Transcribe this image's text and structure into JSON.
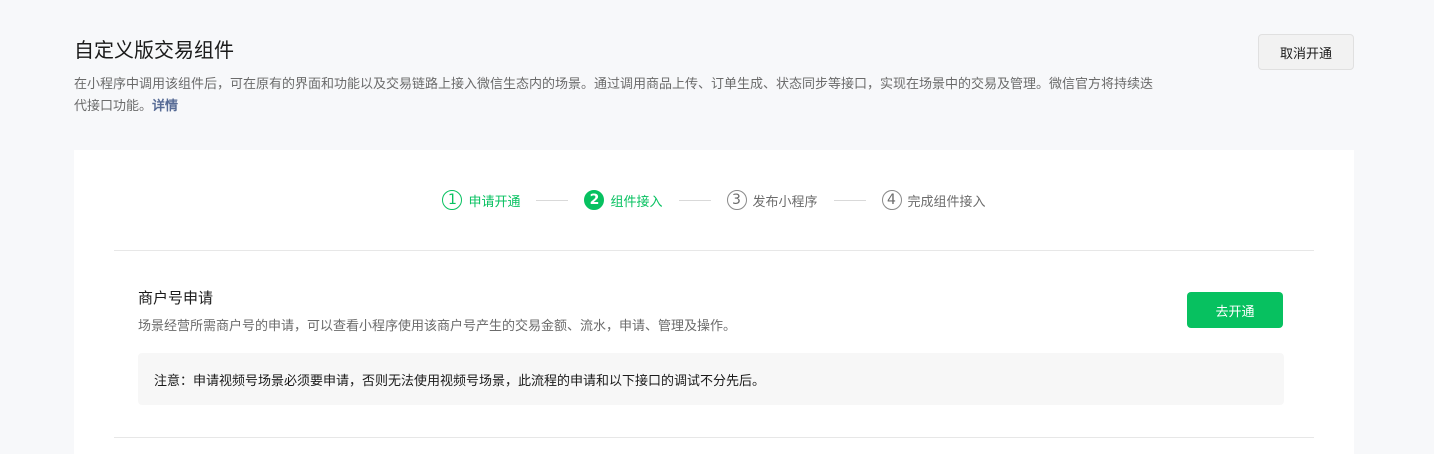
{
  "header": {
    "title": "自定义版交易组件",
    "description": "在小程序中调用该组件后，可在原有的界面和功能以及交易链路上接入微信生态内的场景。通过调用商品上传、订单生成、状态同步等接口，实现在场景中的交易及管理。微信官方将持续迭代接口功能。",
    "details_link": "详情",
    "cancel_label": "取消开通"
  },
  "steps": [
    {
      "num": "1",
      "label": "申请开通",
      "state": "done"
    },
    {
      "num": "2",
      "label": "组件接入",
      "state": "active"
    },
    {
      "num": "3",
      "label": "发布小程序",
      "state": "pending"
    },
    {
      "num": "4",
      "label": "完成组件接入",
      "state": "pending"
    }
  ],
  "merchant": {
    "title": "商户号申请",
    "description": "场景经营所需商户号的申请，可以查看小程序使用该商户号产生的交易金额、流水，申请、管理及操作。",
    "open_label": "去开通",
    "notice": "注意：申请视频号场景必须要申请，否则无法使用视频号场景，此流程的申请和以下接口的调试不分先后。"
  },
  "colors": {
    "accent": "#07c160",
    "link": "#576b95"
  }
}
